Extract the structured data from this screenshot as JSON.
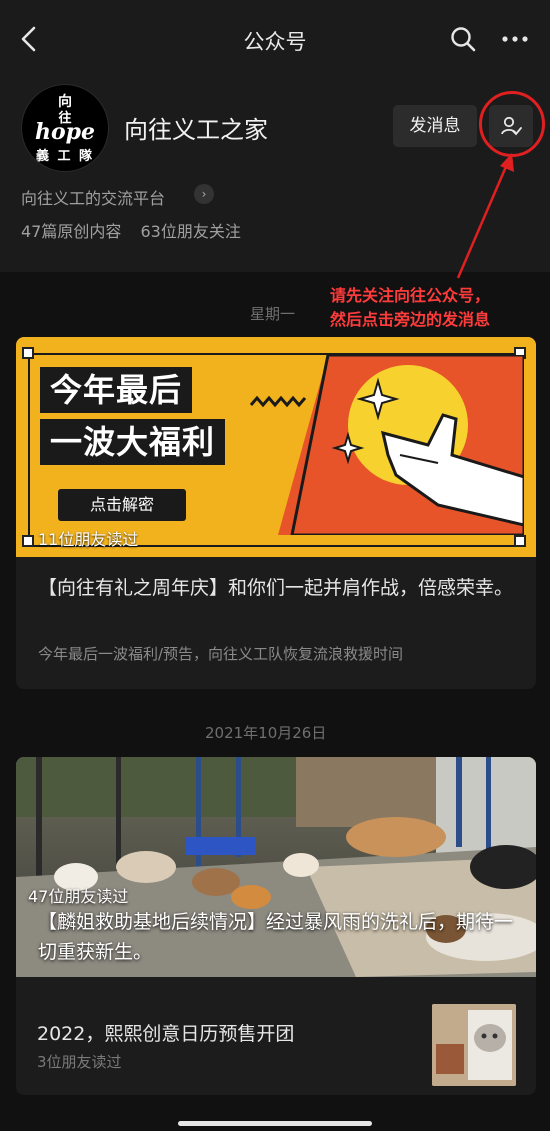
{
  "nav": {
    "title": "公众号",
    "back_icon": "chevron-left-icon",
    "search_icon": "search-icon",
    "more_icon": "more-dots-icon"
  },
  "profile": {
    "avatar_lines": [
      "向",
      "往",
      "hope",
      "義 工 隊"
    ],
    "name": "向往义工之家",
    "message_button": "发消息",
    "follow_icon": "follow-user-icon",
    "intro": "向往义工的交流平台",
    "original_count": "47篇原创内容",
    "friends_following": "63位朋友关注"
  },
  "annotation": {
    "line1": "请先关注向往公众号，",
    "line2": "然后点击旁边的发消息",
    "color": "#ff3b3b"
  },
  "feed": {
    "date1": "星期一",
    "article1": {
      "banner_line1": "今年最后",
      "banner_line2": "一波大福利",
      "banner_cta": "点击解密",
      "readers": "11位朋友读过",
      "title": "【向往有礼之周年庆】和你们一起并肩作战，倍感荣幸。",
      "subtitle": "今年最后一波福利/预告，向往义工队恢复流浪救援时间"
    },
    "date2": "2021年10月26日",
    "article2": {
      "readers": "47位朋友读过",
      "title": "【麟姐救助基地后续情况】经过暴风雨的洗礼后，期待一切重获新生。"
    },
    "article3": {
      "title": "2022，熙熙创意日历预售开团",
      "readers": "3位朋友读过"
    }
  },
  "colors": {
    "background": "#111111",
    "banner_yellow": "#f2b21d",
    "banner_orange": "#e8542a",
    "annotation_red": "#e02020"
  }
}
